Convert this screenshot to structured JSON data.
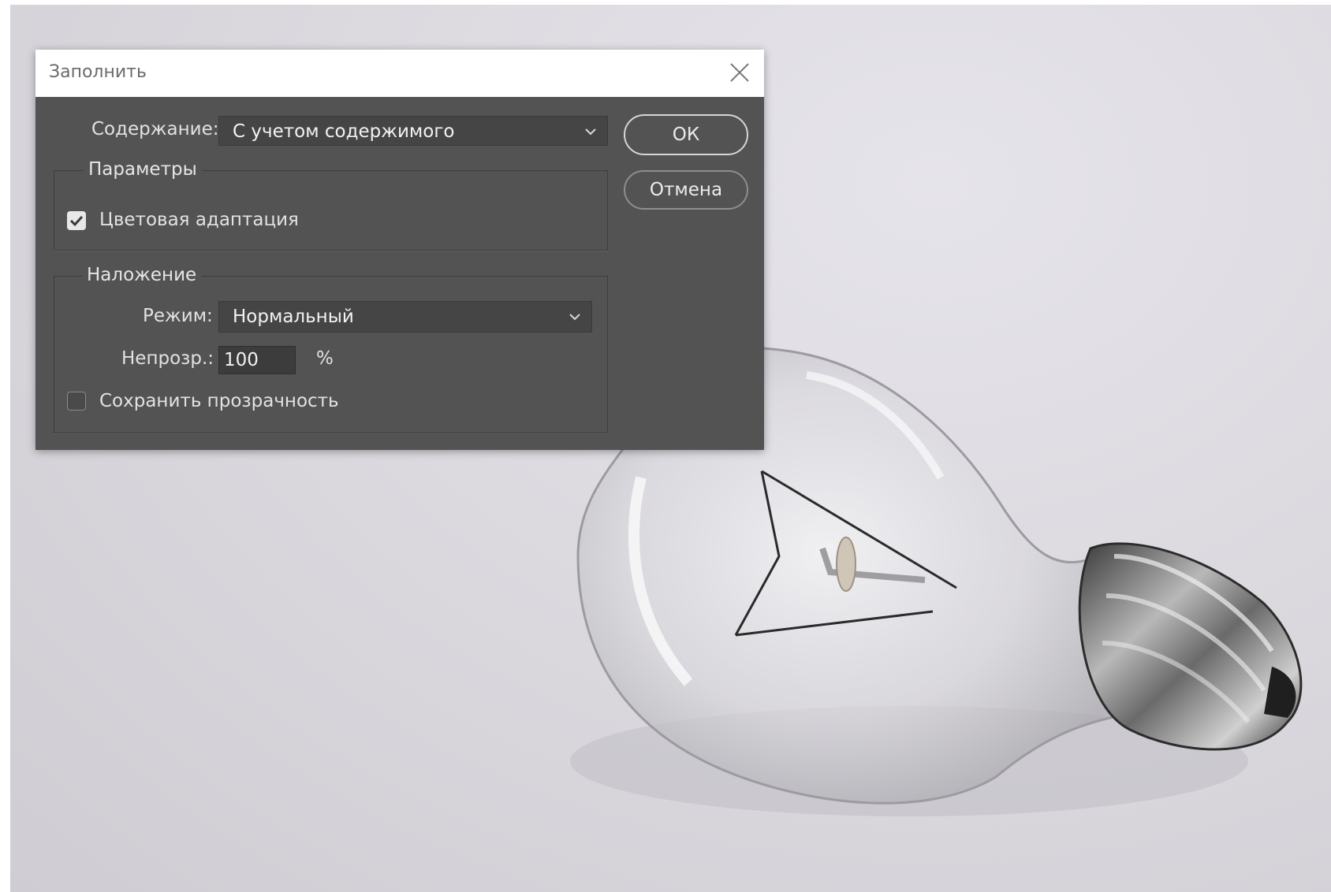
{
  "dialog": {
    "title": "Заполнить",
    "content_label": "Содержание:",
    "content_value": "С учетом содержимого",
    "ok_label": "ОК",
    "cancel_label": "Отмена",
    "params_group": {
      "legend": "Параметры",
      "color_adapt_label": "Цветовая адаптация",
      "color_adapt_checked": true
    },
    "blend_group": {
      "legend": "Наложение",
      "mode_label": "Режим:",
      "mode_value": "Нормальный",
      "opacity_label": "Непрозр.:",
      "opacity_value": "100",
      "opacity_unit": "%",
      "preserve_transparency_label": "Сохранить прозрачность",
      "preserve_transparency_checked": false
    }
  },
  "icons": {
    "close": "close-icon",
    "chevron": "chevron-down-icon",
    "check": "checkmark-icon"
  },
  "colors": {
    "dialog_bg": "#535353",
    "titlebar_bg": "#ffffff",
    "field_bg": "#454545",
    "text": "#e2e2e2"
  }
}
